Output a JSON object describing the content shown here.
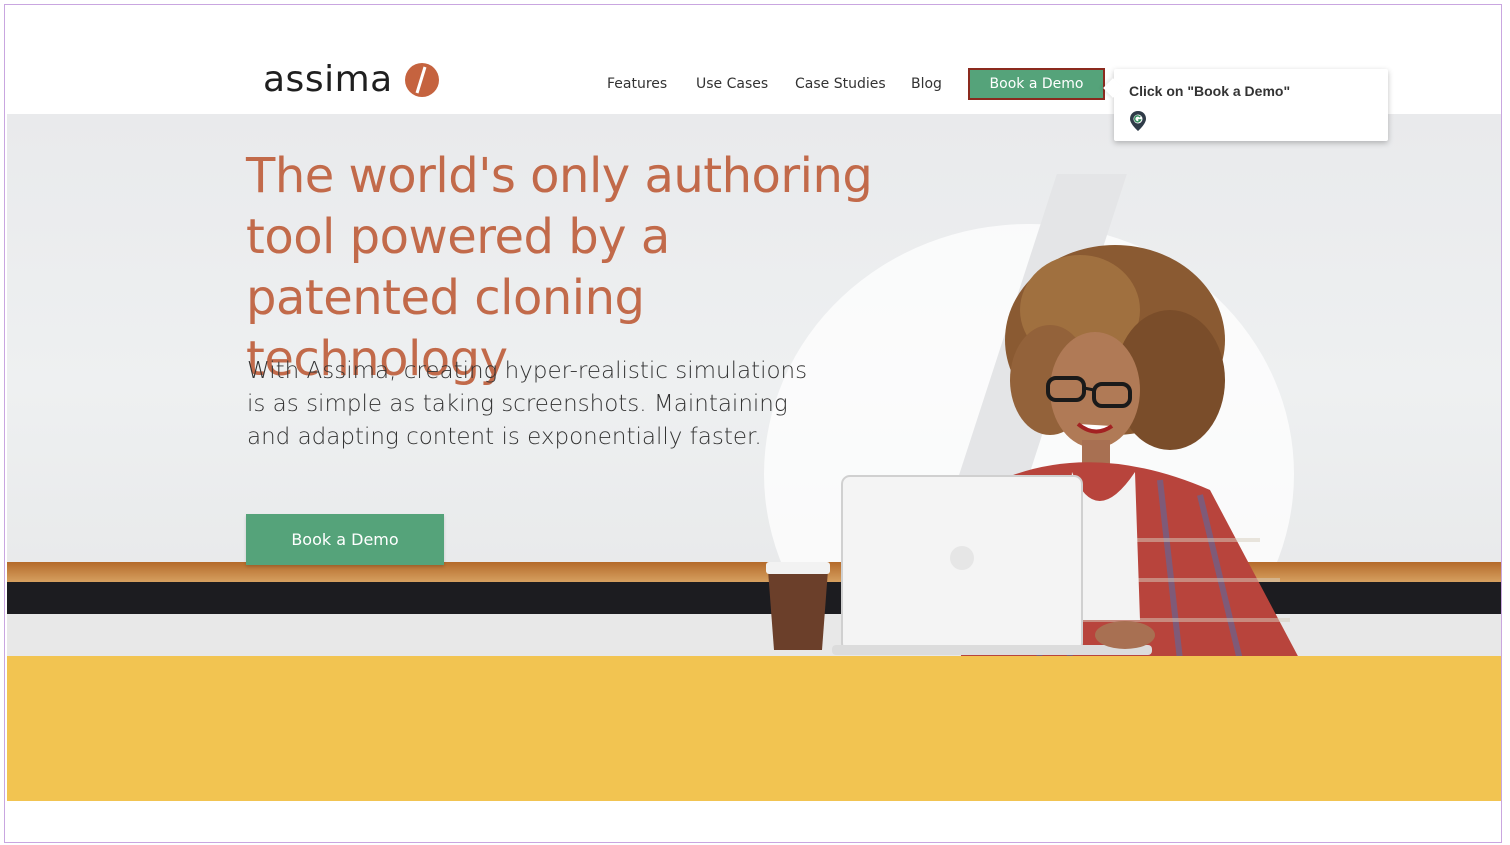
{
  "brand": {
    "name": "assima",
    "accent_color": "#c5633f",
    "button_color": "#55a37a",
    "yellow_band": "#f2c451"
  },
  "nav": {
    "items": [
      {
        "label": "Features"
      },
      {
        "label": "Use Cases"
      },
      {
        "label": "Case Studies"
      },
      {
        "label": "Blog"
      }
    ],
    "cta_label": "Book a Demo"
  },
  "tooltip": {
    "text": "Click on \"Book a Demo\"",
    "icon": "location-pin-icon"
  },
  "hero": {
    "title": "The world's only authoring tool powered by a patented cloning technology",
    "subtitle": "With Assima, creating hyper-realistic simulations is as simple as taking screenshots. Maintaining and adapting content is exponentially faster.",
    "cta_label": "Book a Demo",
    "image": "woman-with-laptop-and-coffee"
  }
}
